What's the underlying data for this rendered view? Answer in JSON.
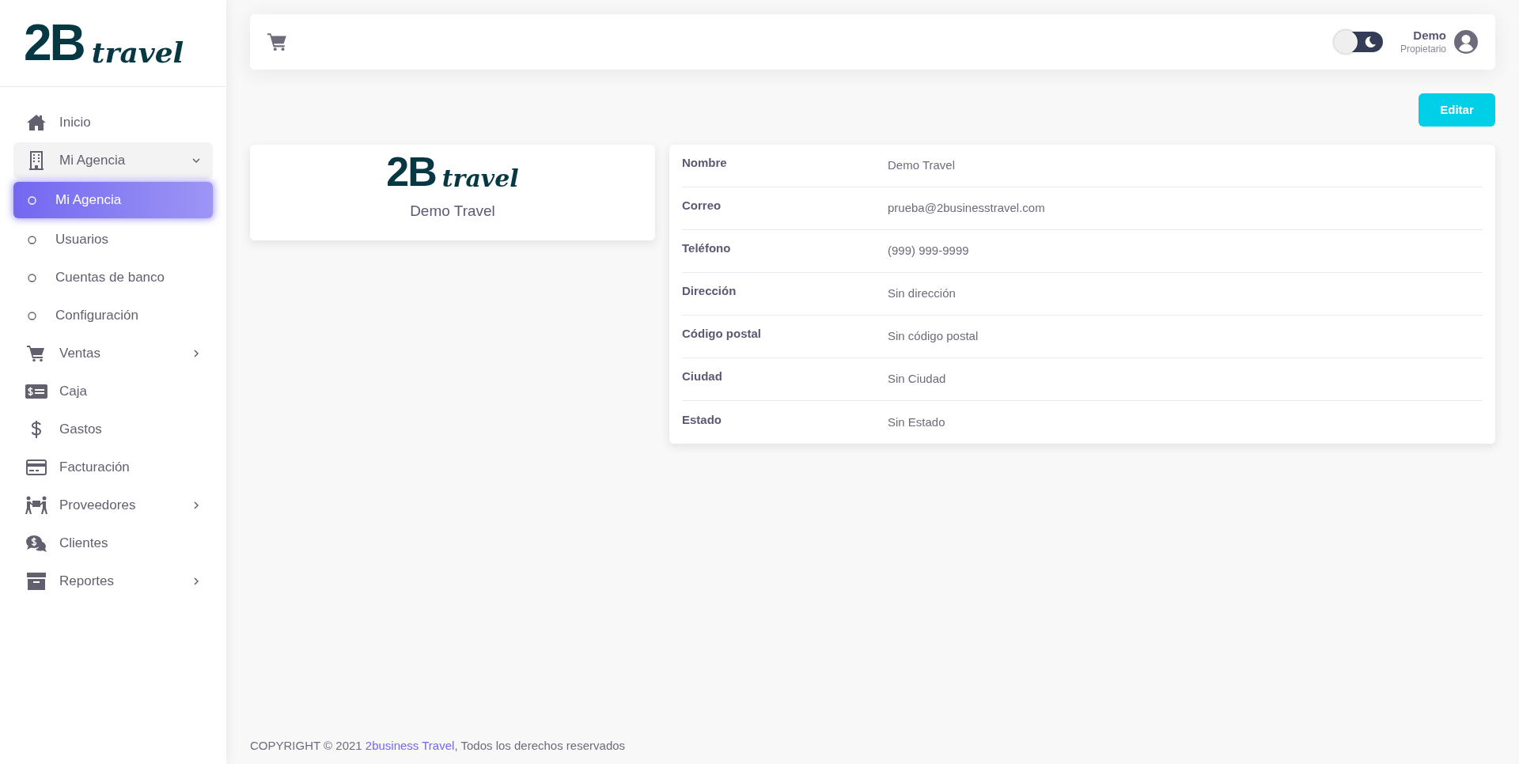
{
  "sidebar": {
    "logo": {
      "main": "2B",
      "script": "travel"
    },
    "items": [
      {
        "label": "Inicio",
        "selected": false
      },
      {
        "label": "Mi Agencia",
        "selected": false,
        "expanded": true,
        "children": [
          {
            "label": "Mi Agencia",
            "selected": true
          },
          {
            "label": "Usuarios",
            "selected": false
          },
          {
            "label": "Cuentas de banco",
            "selected": false
          },
          {
            "label": "Configuración",
            "selected": false
          }
        ]
      },
      {
        "label": "Ventas",
        "selected": false,
        "expanded": false
      },
      {
        "label": "Caja",
        "selected": false
      },
      {
        "label": "Gastos",
        "selected": false
      },
      {
        "label": "Facturación",
        "selected": false
      },
      {
        "label": "Proveedores",
        "selected": false,
        "expanded": false
      },
      {
        "label": "Clientes",
        "selected": false
      },
      {
        "label": "Reportes",
        "selected": false,
        "expanded": false
      }
    ]
  },
  "header": {
    "dark_mode": false,
    "user": {
      "name": "Demo",
      "role": "Propietario"
    }
  },
  "edit_button": "Editar",
  "agency_card": {
    "logo": {
      "main": "2B",
      "script": "travel"
    },
    "name": "Demo Travel"
  },
  "details": [
    {
      "label": "Nombre",
      "value": "Demo Travel"
    },
    {
      "label": "Correo",
      "value": "prueba@2businesstravel.com"
    },
    {
      "label": "Teléfono",
      "value": "(999) 999-9999"
    },
    {
      "label": "Dirección",
      "value": "Sin dirección"
    },
    {
      "label": "Código postal",
      "value": "Sin código postal"
    },
    {
      "label": "Ciudad",
      "value": "Sin Ciudad"
    },
    {
      "label": "Estado",
      "value": "Sin Estado"
    }
  ],
  "footer": {
    "before": "COPYRIGHT © 2021 ",
    "link": "2business Travel",
    "after": ", Todos los derechos reservados"
  }
}
